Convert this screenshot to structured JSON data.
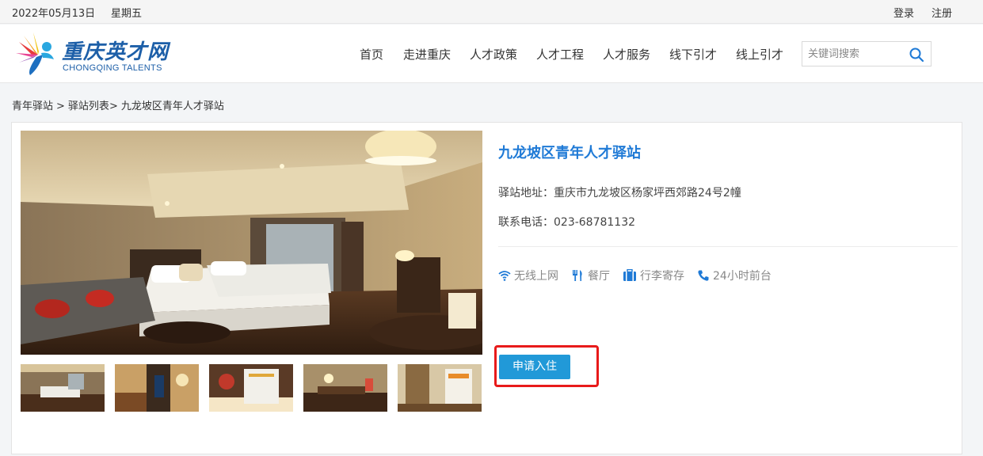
{
  "topbar": {
    "date": "2022年05月13日",
    "weekday": "星期五",
    "login": "登录",
    "register": "注册"
  },
  "logo": {
    "cn": "重庆英才网",
    "en": "CHONGQING TALENTS"
  },
  "nav": [
    "首页",
    "走进重庆",
    "人才政策",
    "人才工程",
    "人才服务",
    "线下引才",
    "线上引才"
  ],
  "search": {
    "placeholder": "关键词搜索"
  },
  "breadcrumb": [
    "青年驿站",
    "驿站列表",
    "九龙坡区青年人才驿站"
  ],
  "station": {
    "name": "九龙坡区青年人才驿站",
    "address": "驿站地址：重庆市九龙坡区杨家坪西郊路24号2幢",
    "phone": "联系电话：023-68781132",
    "amenities": [
      {
        "icon": "wifi-icon",
        "label": "无线上网"
      },
      {
        "icon": "restaurant-icon",
        "label": "餐厅"
      },
      {
        "icon": "luggage-icon",
        "label": "行李寄存"
      },
      {
        "icon": "phone-icon",
        "label": "24小时前台"
      }
    ],
    "apply_label": "申请入住"
  },
  "colors": {
    "accent": "#1f7ad6",
    "button": "#2199d8",
    "highlight": "#e81a1a"
  }
}
